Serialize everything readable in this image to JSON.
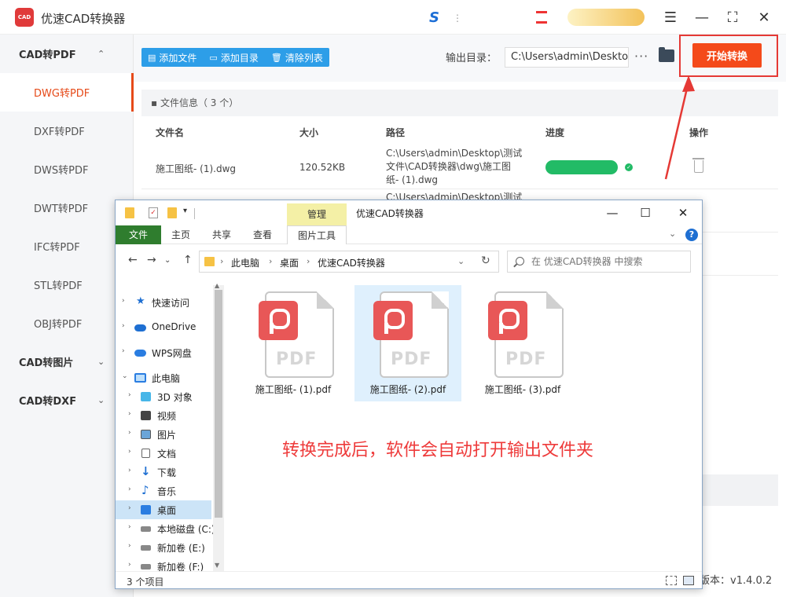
{
  "app": {
    "logo_text": "CAD",
    "title": "优速CAD转换器",
    "version": "版本：v1.4.0.2"
  },
  "sidebar": {
    "categories": [
      {
        "label": "CAD转PDF",
        "caret": "⌃"
      },
      {
        "label": "CAD转图片",
        "caret": "⌄"
      },
      {
        "label": "CAD转DXF",
        "caret": "⌄"
      }
    ],
    "items": [
      {
        "label": "DWG转PDF"
      },
      {
        "label": "DXF转PDF"
      },
      {
        "label": "DWS转PDF"
      },
      {
        "label": "DWT转PDF"
      },
      {
        "label": "IFC转PDF"
      },
      {
        "label": "STL转PDF"
      },
      {
        "label": "OBJ转PDF"
      }
    ],
    "active_index": 0
  },
  "toolbar": {
    "add_file": "添加文件",
    "add_dir": "添加目录",
    "clear_list": "清除列表",
    "output_label": "输出目录：",
    "output_path": "C:\\Users\\admin\\Deskto",
    "more": "···",
    "start": "开始转换"
  },
  "file_list": {
    "header": "文件信息（ 3 个）",
    "columns": [
      "文件名",
      "大小",
      "路径",
      "进度",
      "操作"
    ],
    "rows": [
      {
        "name": "施工图纸- (1).dwg",
        "size": "120.52KB",
        "path": "C:\\Users\\admin\\Desktop\\测试\n文件\\CAD转换器\\dwg\\施工图\n纸- (1).dwg",
        "progress": 1.0
      }
    ],
    "partial_row_path": "C:\\Users\\admin\\Desktop\\测试"
  },
  "explorer": {
    "title": "优速CAD转换器",
    "manage_tab": "管理",
    "tabs": [
      "文件",
      "主页",
      "共享",
      "查看",
      "图片工具"
    ],
    "breadcrumb": [
      "此电脑",
      "桌面",
      "优速CAD转换器"
    ],
    "search_placeholder": "在 优速CAD转换器 中搜索",
    "nav": [
      {
        "label": "快速访问",
        "icon": "star-icon",
        "level": 0,
        "chevron": "›"
      },
      {
        "label": "OneDrive",
        "icon": "cloud-icon",
        "level": 0,
        "chevron": "›"
      },
      {
        "label": "WPS网盘",
        "icon": "wps-cloud-icon",
        "level": 0,
        "chevron": "›"
      },
      {
        "label": "此电脑",
        "icon": "computer-icon",
        "level": 0,
        "chevron": "⌄"
      },
      {
        "label": "3D 对象",
        "icon": "cube-icon",
        "level": 1,
        "chevron": "›"
      },
      {
        "label": "视频",
        "icon": "video-icon",
        "level": 1,
        "chevron": "›"
      },
      {
        "label": "图片",
        "icon": "picture-icon",
        "level": 1,
        "chevron": "›"
      },
      {
        "label": "文档",
        "icon": "document-icon",
        "level": 1,
        "chevron": "›"
      },
      {
        "label": "下载",
        "icon": "download-icon",
        "level": 1,
        "chevron": "›"
      },
      {
        "label": "音乐",
        "icon": "music-icon",
        "level": 1,
        "chevron": "›"
      },
      {
        "label": "桌面",
        "icon": "desktop-icon",
        "level": 1,
        "chevron": "›"
      },
      {
        "label": "本地磁盘 (C:)",
        "icon": "drive-icon",
        "level": 1,
        "chevron": "›"
      },
      {
        "label": "新加卷 (E:)",
        "icon": "drive-icon",
        "level": 1,
        "chevron": "›"
      },
      {
        "label": "新加卷 (F:)",
        "icon": "drive-icon",
        "level": 1,
        "chevron": "›"
      }
    ],
    "selected_nav": 10,
    "files": [
      {
        "name": "施工图纸- (1).pdf"
      },
      {
        "name": "施工图纸- (2).pdf"
      },
      {
        "name": "施工图纸- (3).pdf"
      }
    ],
    "selected_file": 1,
    "status": "3 个项目",
    "note": "转换完成后，软件会自动打开输出文件夹"
  },
  "colors": {
    "accent": "#f44a1a",
    "highlight_red": "#e53935",
    "tool_blue": "#2d9ee8",
    "progress_green": "#22bb66"
  }
}
